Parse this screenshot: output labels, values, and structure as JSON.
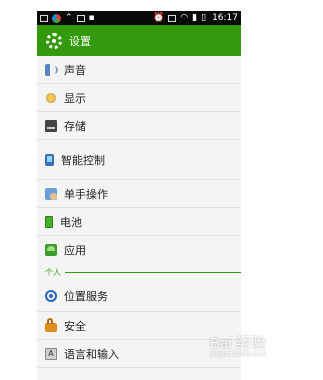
{
  "status_bar": {
    "time": "16:17",
    "left_icons": [
      "sd-card-icon",
      "app-circle-icon",
      "alert-icon",
      "image-icon",
      "menu-icon"
    ],
    "right_icons": [
      "alarm-icon",
      "silent-icon",
      "wifi-icon",
      "signal-icon",
      "battery-icon"
    ]
  },
  "header": {
    "title": "设置",
    "accent_color": "#339a0d"
  },
  "settings": {
    "items": [
      {
        "label": "声音",
        "icon": "sound-icon"
      },
      {
        "label": "显示",
        "icon": "display-icon"
      },
      {
        "label": "存储",
        "icon": "storage-icon"
      },
      {
        "label": "智能控制",
        "icon": "smart-control-icon"
      },
      {
        "label": "单手操作",
        "icon": "one-hand-icon"
      },
      {
        "label": "电池",
        "icon": "battery-icon"
      },
      {
        "label": "应用",
        "icon": "apps-icon"
      }
    ],
    "personal_header": "个人",
    "personal_items": [
      {
        "label": "位置服务",
        "icon": "location-icon"
      },
      {
        "label": "安全",
        "icon": "security-icon"
      },
      {
        "label": "语言和输入",
        "icon": "language-icon"
      }
    ]
  },
  "watermark": {
    "brand": "Bai 经验",
    "url": "jingyan.baidu.com"
  }
}
